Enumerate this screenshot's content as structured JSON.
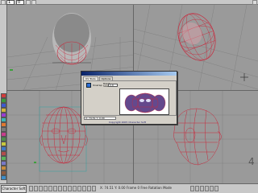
{
  "toolbar": {
    "field_a": "1",
    "field_b": "0"
  },
  "left_tools": {
    "icons": [
      "select-icon",
      "move-icon",
      "rotate-icon",
      "scale-icon",
      "link-icon",
      "camera-icon",
      "light-icon",
      "paint-icon",
      "render-icon",
      "material-icon",
      "bones-icon",
      "morph-icon",
      "uv-icon",
      "helper-icon",
      "view-icon",
      "layers-icon",
      "script-icon",
      "help-icon"
    ],
    "colors": [
      "#d23c3c",
      "#3c9a3c",
      "#3c5ad2",
      "#d2b43c",
      "#9a3cd2",
      "#3cb4b4",
      "#e07830",
      "#7a7a7a",
      "#c83c8c",
      "#4c8c4c",
      "#c8c83c",
      "#3c78c8",
      "#b44c4c",
      "#5ab45a",
      "#7878c8",
      "#c88c3c",
      "#8c5a3c",
      "#3c8cc8"
    ]
  },
  "viewports": {
    "top_left": "",
    "top_right": "",
    "bottom_left": "",
    "bottom_right": ""
  },
  "dialog": {
    "tab_1": "UV Tools",
    "tab_2": "Options",
    "label_1": "Unwrap",
    "label_2": "Reset",
    "label_3": "Size",
    "size_value": "1.0",
    "status": "X: 74.51  Y: 0.00",
    "copyright": "Copyright 2005 Character Soft"
  },
  "statusbar": {
    "start_label": "Character Soft",
    "status_text": "X: 74.51  Y: 0.00   Frame 0   Free Rotation Mode"
  },
  "colors": {
    "wireframe": "#c8283c",
    "grid": "#7c7c7c",
    "accent": "#0a246a"
  }
}
